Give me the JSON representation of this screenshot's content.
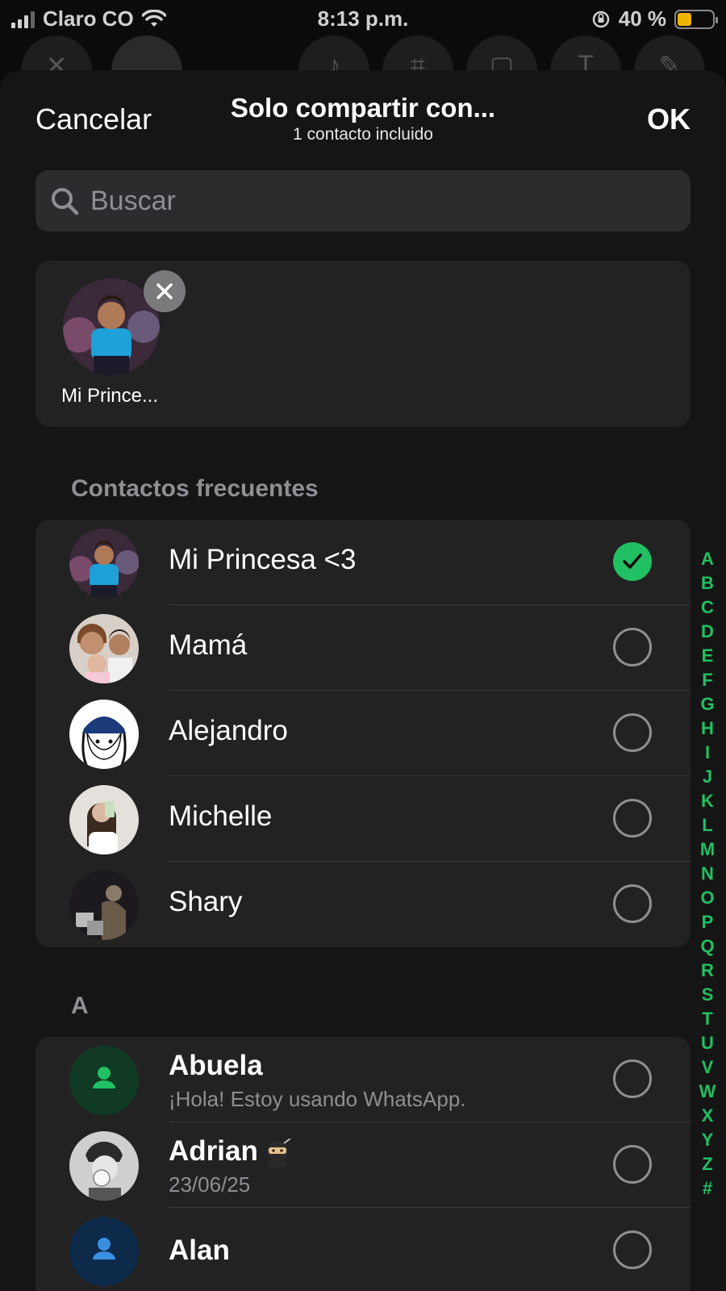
{
  "status_bar": {
    "carrier": "Claro CO",
    "time": "8:13 p.m.",
    "battery_percent": "40 %",
    "battery_level": 0.4
  },
  "sheet": {
    "cancel_label": "Cancelar",
    "title": "Solo compartir con...",
    "subtitle": "1 contacto incluido",
    "ok_label": "OK",
    "search_placeholder": "Buscar"
  },
  "selected": [
    {
      "name": "Mi Prince..."
    }
  ],
  "frequent": {
    "header": "Contactos frecuentes",
    "contacts": [
      {
        "name": "Mi Princesa <3",
        "checked": true
      },
      {
        "name": "Mamá",
        "checked": false
      },
      {
        "name": "Alejandro",
        "checked": false
      },
      {
        "name": "Michelle",
        "checked": false
      },
      {
        "name": "Shary",
        "checked": false
      }
    ]
  },
  "section_a": {
    "header": "A",
    "contacts": [
      {
        "name": "Abuela",
        "status": "¡Hola! Estoy usando WhatsApp.",
        "checked": false
      },
      {
        "name": "Adrian",
        "status": "23/06/25",
        "checked": false
      },
      {
        "name": "Alan",
        "status": "",
        "checked": false
      }
    ]
  },
  "alphabet_index": [
    "A",
    "B",
    "C",
    "D",
    "E",
    "F",
    "G",
    "H",
    "I",
    "J",
    "K",
    "L",
    "M",
    "N",
    "O",
    "P",
    "Q",
    "R",
    "S",
    "T",
    "U",
    "V",
    "W",
    "X",
    "Y",
    "Z",
    "#"
  ],
  "colors": {
    "accent_green": "#21c063",
    "sheet_bg": "#151515",
    "group_bg": "#222222",
    "muted_text": "#8e8e93"
  }
}
